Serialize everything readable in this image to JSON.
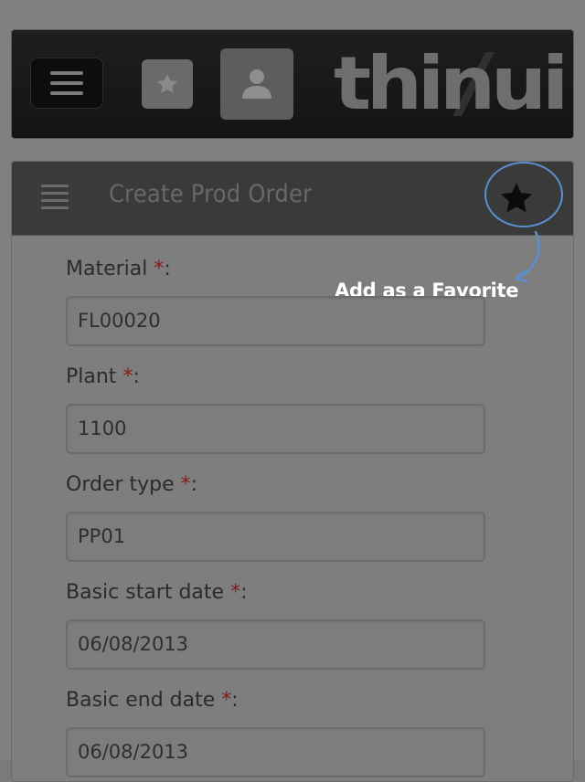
{
  "app": {
    "logo_text": "thinui",
    "menu_icon": "hamburger-icon",
    "favorites_icon": "star-icon",
    "user_icon": "user-icon"
  },
  "panel": {
    "title": "Create Prod Order",
    "list_icon": "list-icon",
    "favorite_icon": "star-icon"
  },
  "annotation": {
    "text": "Add as a Favorite",
    "color": "#5b8fcf"
  },
  "form": {
    "required_marker": "*",
    "fields": [
      {
        "label": "Material",
        "value": "FL00020"
      },
      {
        "label": "Plant",
        "value": "1100"
      },
      {
        "label": "Order type",
        "value": "PP01"
      },
      {
        "label": "Basic start date",
        "value": "06/08/2013"
      },
      {
        "label": "Basic end date",
        "value": "06/08/2013"
      }
    ]
  },
  "colors": {
    "required": "#8a1a1a",
    "overlay_background": "#808080"
  }
}
